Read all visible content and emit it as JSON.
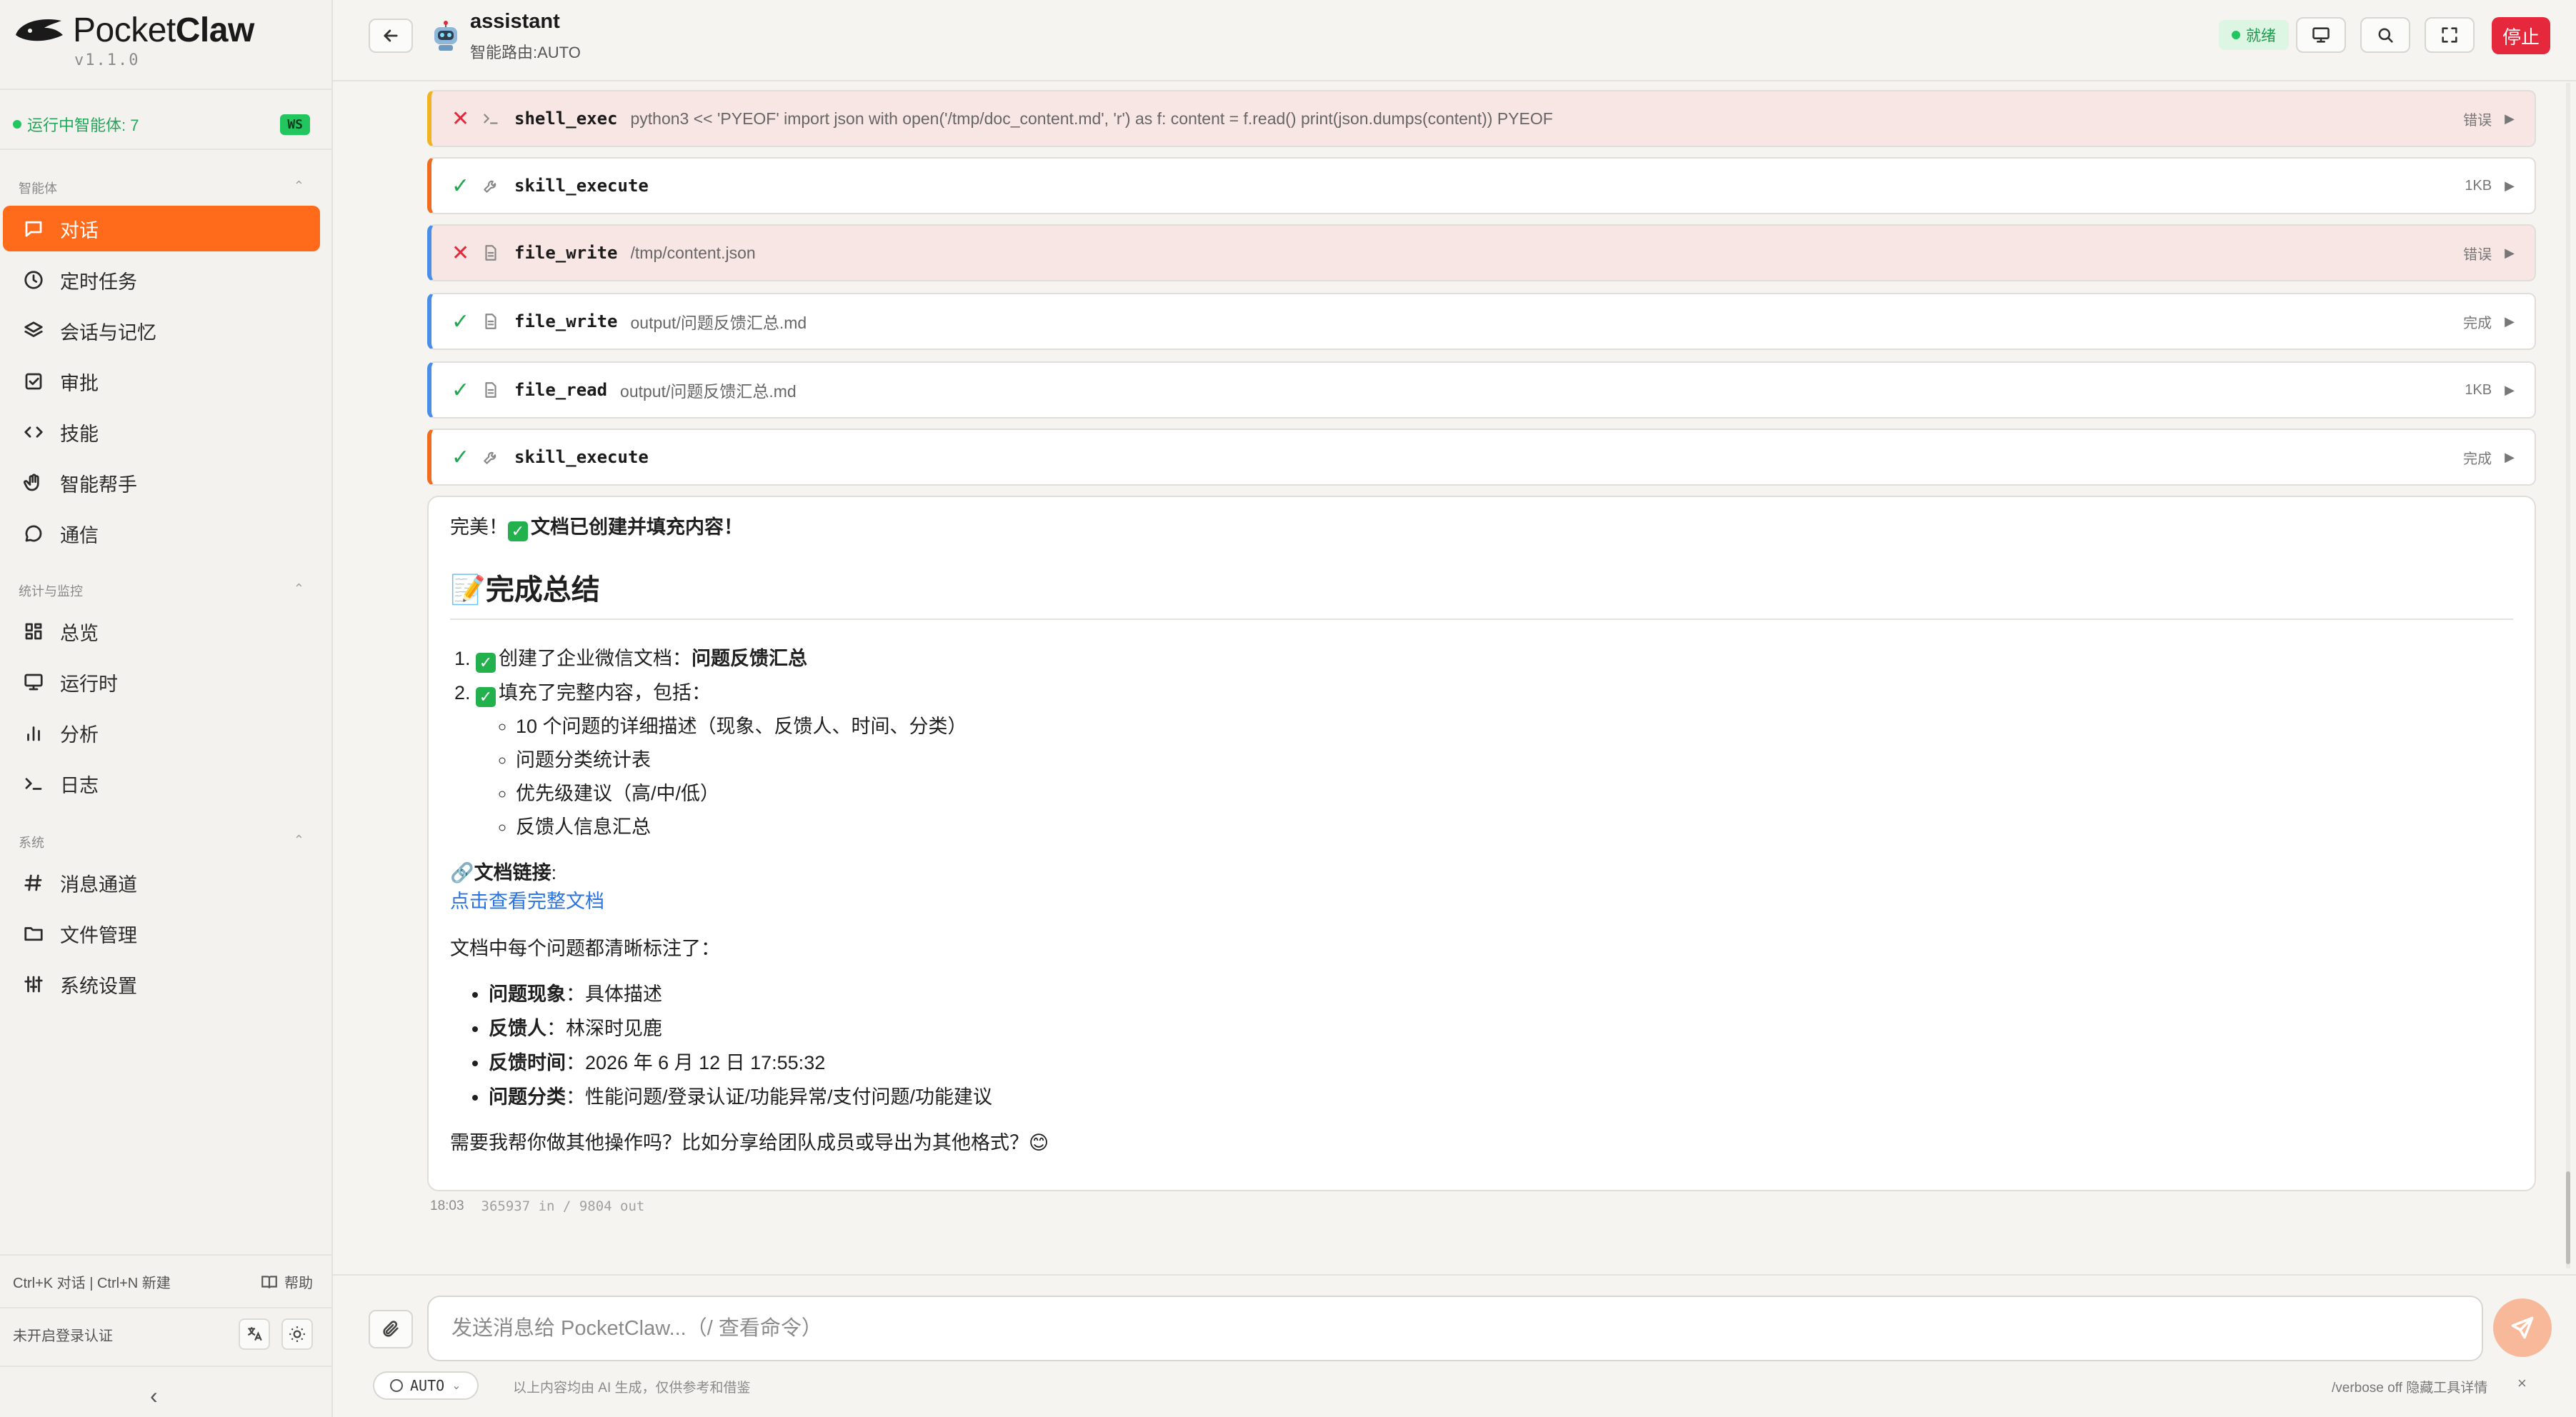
{
  "brand": {
    "name_regular": "Pocket",
    "name_bold": "Claw",
    "version": "v1.1.0"
  },
  "sidebar": {
    "agents_running": "运行中智能体: 7",
    "ws_badge": "WS",
    "sections": [
      {
        "title": "智能体",
        "items": [
          {
            "label": "对话",
            "icon": "chat-icon",
            "active": true
          },
          {
            "label": "定时任务",
            "icon": "clock-icon"
          },
          {
            "label": "会话与记忆",
            "icon": "layers-icon"
          },
          {
            "label": "审批",
            "icon": "check-square-icon"
          },
          {
            "label": "技能",
            "icon": "code-icon"
          },
          {
            "label": "智能帮手",
            "icon": "hand-icon"
          },
          {
            "label": "通信",
            "icon": "message-circle-icon"
          }
        ]
      },
      {
        "title": "统计与监控",
        "items": [
          {
            "label": "总览",
            "icon": "grid-icon"
          },
          {
            "label": "运行时",
            "icon": "monitor-icon"
          },
          {
            "label": "分析",
            "icon": "bar-chart-icon"
          },
          {
            "label": "日志",
            "icon": "terminal-icon"
          }
        ]
      },
      {
        "title": "系统",
        "items": [
          {
            "label": "消息通道",
            "icon": "hash-icon"
          },
          {
            "label": "文件管理",
            "icon": "folder-icon"
          },
          {
            "label": "系统设置",
            "icon": "sliders-icon"
          }
        ]
      }
    ],
    "shortcuts": "Ctrl+K 对话 | Ctrl+N 新建",
    "help_label": "帮助",
    "auth_status": "未开启登录认证",
    "collapse_icon": "chevron-left-icon"
  },
  "header": {
    "agent_name": "assistant",
    "route": "智能路由:AUTO",
    "status": "就绪",
    "stop_label": "停止",
    "buttons": [
      "monitor-icon",
      "search-icon",
      "fullscreen-icon"
    ]
  },
  "tool_calls": [
    {
      "status": "error",
      "icon": "terminal-icon",
      "name": "shell_exec",
      "detail": "python3 << 'PYEOF' import json with open('/tmp/doc_content.md', 'r') as f: content = f.read() print(json.dumps(content)) PYEOF",
      "right": "错误",
      "accent": "#f2b320"
    },
    {
      "status": "ok",
      "icon": "wrench-icon",
      "name": "skill_execute",
      "detail": "",
      "right": "1KB",
      "accent": "#f06d1f"
    },
    {
      "status": "error",
      "icon": "file-icon",
      "name": "file_write",
      "detail": "/tmp/content.json",
      "right": "错误",
      "accent": "#4a8ee8"
    },
    {
      "status": "ok",
      "icon": "file-icon",
      "name": "file_write",
      "detail": "output/问题反馈汇总.md",
      "right": "完成",
      "accent": "#4a8ee8"
    },
    {
      "status": "ok",
      "icon": "file-icon",
      "name": "file_read",
      "detail": "output/问题反馈汇总.md",
      "right": "1KB",
      "accent": "#4a8ee8"
    },
    {
      "status": "ok",
      "icon": "wrench-icon",
      "name": "skill_execute",
      "detail": "",
      "right": "完成",
      "accent": "#f06d1f"
    }
  ],
  "message": {
    "intro_plain": "完美！",
    "intro_bold": "文档已创建并填充内容！",
    "summary_emoji": "📝",
    "summary_title": "完成总结",
    "step1_plain": "创建了企业微信文档：",
    "step1_bold": "问题反馈汇总",
    "step2": "填充了完整内容，包括：",
    "step2_items": [
      "10 个问题的详细描述（现象、反馈人、时间、分类）",
      "问题分类统计表",
      "优先级建议（高/中/低）",
      "反馈人信息汇总"
    ],
    "link_emoji": "🔗",
    "link_label": "文档链接",
    "link_colon": ":",
    "link_text": "点击查看完整文档",
    "marked_intro": "文档中每个问题都清晰标注了：",
    "fields": [
      {
        "key": "问题现象",
        "value": "：具体描述"
      },
      {
        "key": "反馈人",
        "value": "：林深时见鹿"
      },
      {
        "key": "反馈时间",
        "value": "：2026 年 6 月 12 日 17:55:32"
      },
      {
        "key": "问题分类",
        "value": "：性能问题/登录认证/功能异常/支付问题/功能建议"
      }
    ],
    "closing": "需要我帮你做其他操作吗？比如分享给团队成员或导出为其他格式？😊",
    "time": "18:03",
    "tokens": "365937 in / 9804 out"
  },
  "composer": {
    "placeholder": "发送消息给 PocketClaw...（/ 查看命令）",
    "mode": "AUTO",
    "disclaimer": "以上内容均由 AI 生成，仅供参考和借鉴",
    "verbose_hint": "/verbose off 隐藏工具详情",
    "close": "×"
  },
  "colors": {
    "accent": "#ff6b1a",
    "danger": "#e5283c",
    "success": "#22c55e",
    "link": "#2b73e0"
  }
}
